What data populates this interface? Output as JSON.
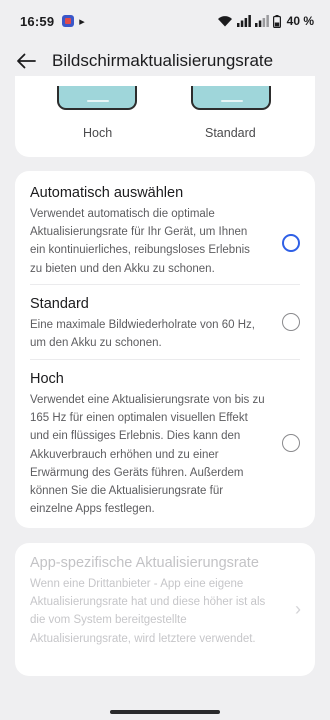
{
  "status_bar": {
    "time": "16:59",
    "battery": "40 %",
    "icons": [
      "app-notification-icon",
      "play-store-icon",
      "wifi-icon",
      "signal-icon",
      "signal-icon",
      "battery-icon"
    ]
  },
  "app_bar": {
    "title": "Bildschirmaktualisierungsrate",
    "back_icon": "arrow-left-icon"
  },
  "preview": {
    "left_label": "Hoch",
    "right_label": "Standard"
  },
  "options": [
    {
      "title": "Automatisch auswählen",
      "description": "Verwendet automatisch die optimale Aktualisierungsrate für Ihr Gerät, um Ihnen ein kontinuierliches, reibungsloses Erlebnis zu bieten und den Akku zu schonen.",
      "selected": true
    },
    {
      "title": "Standard",
      "description": "Eine maximale Bildwiederholrate von 60 Hz, um den Akku zu schonen.",
      "selected": false
    },
    {
      "title": "Hoch",
      "description": "Verwendet eine Aktualisierungsrate von bis zu 165 Hz für einen optimalen visuellen Effekt und ein flüssiges Erlebnis. Dies kann den Akkuverbrauch erhöhen und zu einer Erwärmung des Geräts führen. Außerdem können Sie die Aktualisierungsrate für einzelne Apps festlegen.",
      "selected": false
    }
  ],
  "app_specific": {
    "title": "App-spezifische Aktualisierungsrate",
    "description": "Wenn eine Drittanbieter - App eine eigene Aktualisierungsrate hat und diese höher ist als die vom System bereitgestellte Aktualisierungsrate, wird letztere verwendet.",
    "enabled": false
  },
  "colors": {
    "accent": "#2f60e6",
    "background": "#efeff1",
    "card": "#ffffff",
    "preview_screen": "#9fd6da"
  }
}
